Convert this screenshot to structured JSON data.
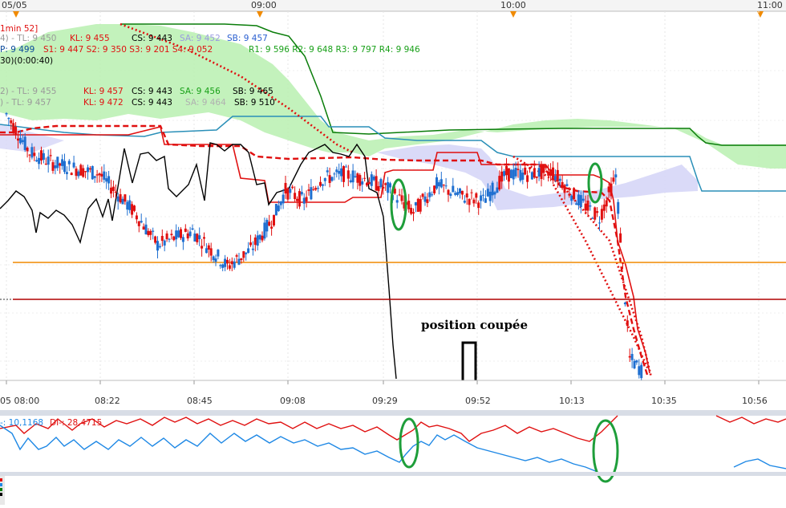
{
  "colors": {
    "up": "#1f6fd0",
    "down": "#e01010",
    "kijun": "#e01010",
    "tenkan": "#e01010",
    "chikou": "#000000",
    "span_a": "#0a7d0a",
    "span_b": "#2a8fb8",
    "cloud_bull": "#b9f0b0",
    "cloud_bear": "#d6d6f7",
    "orange": "#f08a00",
    "darkred": "#b00000",
    "di_plus": "#1e88e5",
    "di_minus": "#e01010",
    "annotation_circle": "#1e9e3a"
  },
  "top_axis": {
    "labels": [
      "05/05",
      "09:00",
      "10:00",
      "11:00"
    ]
  },
  "header": {
    "line1": {
      "prefix": "4) - TL: 9 450",
      "kl": "KL: 9 455",
      "cs": "CS: 9 443",
      "sa": "SA: 9 452",
      "sb": "SB: 9 457",
      "title": "1min 52]"
    },
    "line2": {
      "p": "P: 9 499",
      "s": "S1: 9 447   S2: 9 350   S3: 9 201   S4: 9 052",
      "r": "R1: 9 596   R2: 9 648   R3: 9 797   R4: 9 946"
    },
    "line3": "30)(0:00:40)",
    "line4": {
      "tl": "2) - TL: 9 455",
      "kl": "KL: 9 457",
      "cs": "CS: 9 443",
      "sa": "SA: 9 456",
      "sb": "SB: 9 465"
    },
    "line5": {
      "tl": ") - TL: 9 457",
      "kl": "KL: 9 472",
      "cs": "CS: 9 443",
      "sa": "SA: 9 464",
      "sb": "SB: 9 510"
    }
  },
  "annotation": {
    "text": "position coupée"
  },
  "chart_data": {
    "type": "candlestick",
    "x_labels": [
      "05 08:00",
      "08:22",
      "08:45",
      "09:08",
      "09:29",
      "09:52",
      "10:13",
      "10:35",
      "10:56"
    ],
    "price_series": [
      {
        "t": 0,
        "v": 9468
      },
      {
        "t": 10,
        "v": 9454
      },
      {
        "t": 20,
        "v": 9450
      },
      {
        "t": 30,
        "v": 9448
      },
      {
        "t": 40,
        "v": 9446
      },
      {
        "t": 55,
        "v": 9432
      },
      {
        "t": 65,
        "v": 9420
      },
      {
        "t": 80,
        "v": 9425
      },
      {
        "t": 95,
        "v": 9412
      },
      {
        "t": 105,
        "v": 9418
      },
      {
        "t": 115,
        "v": 9430
      },
      {
        "t": 120,
        "v": 9440
      },
      {
        "t": 128,
        "v": 9436
      },
      {
        "t": 135,
        "v": 9444
      },
      {
        "t": 145,
        "v": 9446
      },
      {
        "t": 155,
        "v": 9444
      },
      {
        "t": 165,
        "v": 9440
      },
      {
        "t": 175,
        "v": 9432
      },
      {
        "t": 185,
        "v": 9442
      },
      {
        "t": 195,
        "v": 9438
      },
      {
        "t": 205,
        "v": 9436
      },
      {
        "t": 215,
        "v": 9446
      },
      {
        "t": 225,
        "v": 9446
      },
      {
        "t": 235,
        "v": 9447
      },
      {
        "t": 245,
        "v": 9437
      },
      {
        "t": 255,
        "v": 9430
      },
      {
        "t": 262,
        "v": 9445
      },
      {
        "t": 268,
        "v": 9378
      },
      {
        "t": 275,
        "v": 9372
      }
    ],
    "orange_level": 9397,
    "darkred_level": 9381,
    "di": {
      "di_plus_label": "-: 10,1168",
      "di_minus_label": "DI-: 28,4715"
    }
  }
}
